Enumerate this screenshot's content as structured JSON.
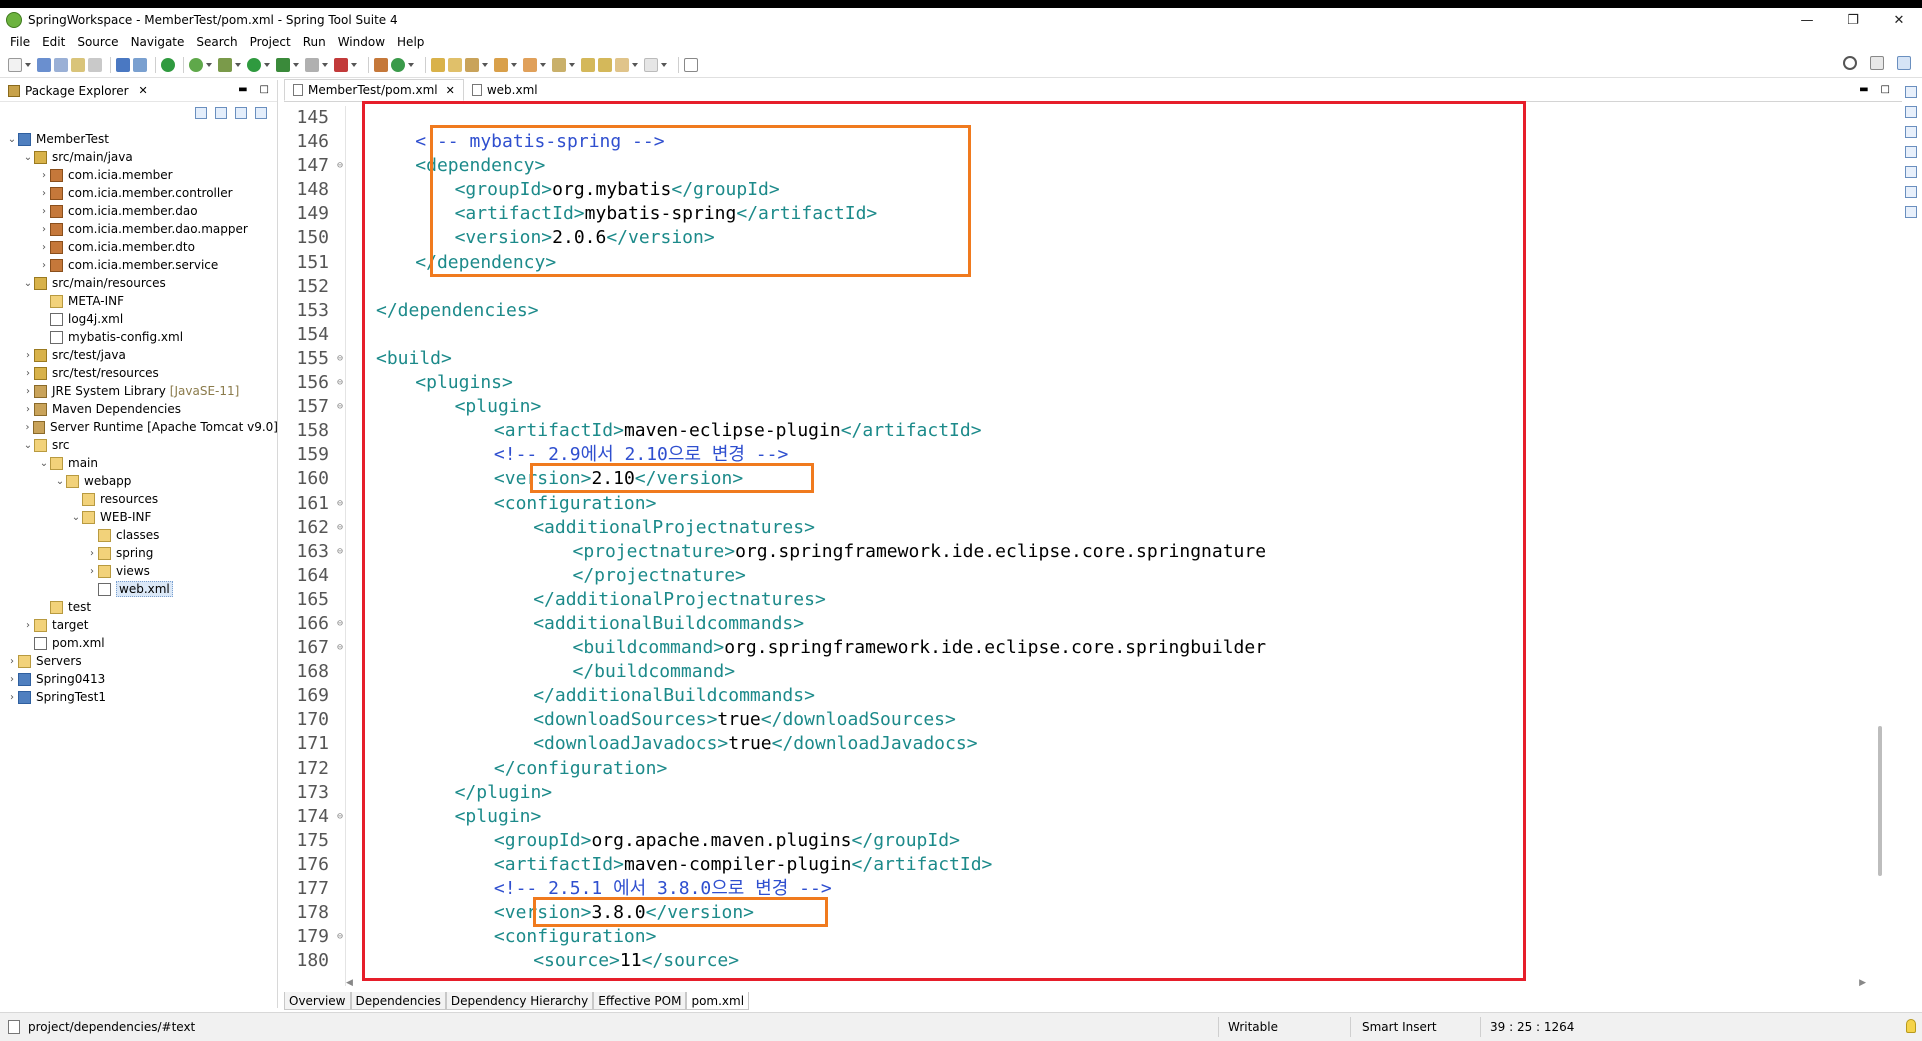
{
  "window": {
    "title": "SpringWorkspace - MemberTest/pom.xml - Spring Tool Suite 4",
    "minimize": "—",
    "maximize": "❐",
    "close": "✕"
  },
  "menus": [
    "File",
    "Edit",
    "Source",
    "Navigate",
    "Search",
    "Project",
    "Run",
    "Window",
    "Help"
  ],
  "package_explorer": {
    "title": "Package Explorer",
    "close": "✕",
    "tree": [
      {
        "depth": 0,
        "tw": "⌄",
        "icon": "project",
        "label": "MemberTest"
      },
      {
        "depth": 1,
        "tw": "⌄",
        "icon": "srcfolder",
        "label": "src/main/java"
      },
      {
        "depth": 2,
        "tw": "›",
        "icon": "package",
        "label": "com.icia.member"
      },
      {
        "depth": 2,
        "tw": "›",
        "icon": "package",
        "label": "com.icia.member.controller"
      },
      {
        "depth": 2,
        "tw": "›",
        "icon": "package",
        "label": "com.icia.member.dao"
      },
      {
        "depth": 2,
        "tw": "›",
        "icon": "package",
        "label": "com.icia.member.dao.mapper"
      },
      {
        "depth": 2,
        "tw": "›",
        "icon": "package",
        "label": "com.icia.member.dto"
      },
      {
        "depth": 2,
        "tw": "›",
        "icon": "package",
        "label": "com.icia.member.service"
      },
      {
        "depth": 1,
        "tw": "⌄",
        "icon": "srcfolder",
        "label": "src/main/resources"
      },
      {
        "depth": 2,
        "tw": "",
        "icon": "folder",
        "label": "META-INF"
      },
      {
        "depth": 2,
        "tw": "",
        "icon": "xml",
        "label": "log4j.xml"
      },
      {
        "depth": 2,
        "tw": "",
        "icon": "xml",
        "label": "mybatis-config.xml"
      },
      {
        "depth": 1,
        "tw": "›",
        "icon": "srcfolder",
        "label": "src/test/java"
      },
      {
        "depth": 1,
        "tw": "›",
        "icon": "srcfolder",
        "label": "src/test/resources"
      },
      {
        "depth": 1,
        "tw": "›",
        "icon": "lib",
        "label": "JRE System Library",
        "suffix": "[JavaSE-11]"
      },
      {
        "depth": 1,
        "tw": "›",
        "icon": "lib",
        "label": "Maven Dependencies"
      },
      {
        "depth": 1,
        "tw": "›",
        "icon": "lib",
        "label": "Server Runtime [Apache Tomcat v9.0]"
      },
      {
        "depth": 1,
        "tw": "⌄",
        "icon": "folder",
        "label": "src"
      },
      {
        "depth": 2,
        "tw": "⌄",
        "icon": "folder",
        "label": "main"
      },
      {
        "depth": 3,
        "tw": "⌄",
        "icon": "folder",
        "label": "webapp"
      },
      {
        "depth": 4,
        "tw": "",
        "icon": "folder",
        "label": "resources"
      },
      {
        "depth": 4,
        "tw": "⌄",
        "icon": "folder",
        "label": "WEB-INF"
      },
      {
        "depth": 5,
        "tw": "",
        "icon": "folder",
        "label": "classes"
      },
      {
        "depth": 5,
        "tw": "›",
        "icon": "folder",
        "label": "spring"
      },
      {
        "depth": 5,
        "tw": "›",
        "icon": "folder",
        "label": "views"
      },
      {
        "depth": 5,
        "tw": "",
        "icon": "xml",
        "label": "web.xml",
        "selected": true
      },
      {
        "depth": 2,
        "tw": "",
        "icon": "folder",
        "label": "test"
      },
      {
        "depth": 1,
        "tw": "›",
        "icon": "folder",
        "label": "target"
      },
      {
        "depth": 1,
        "tw": "",
        "icon": "xml",
        "label": "pom.xml"
      },
      {
        "depth": 0,
        "tw": "›",
        "icon": "folder",
        "label": "Servers"
      },
      {
        "depth": 0,
        "tw": "›",
        "icon": "project",
        "label": "Spring0413"
      },
      {
        "depth": 0,
        "tw": "›",
        "icon": "project",
        "label": "SpringTest1"
      }
    ]
  },
  "editor": {
    "tabs": [
      {
        "label": "MemberTest/pom.xml",
        "active": true,
        "close": "✕"
      },
      {
        "label": "web.xml",
        "active": false
      }
    ],
    "lines": [
      {
        "n": "145",
        "fold": "",
        "indent": 0,
        "segs": []
      },
      {
        "n": "146",
        "fold": "",
        "indent": 1,
        "segs": [
          {
            "t": "<!-- mybatis-spring -->",
            "c": "cmt"
          }
        ]
      },
      {
        "n": "147",
        "fold": "⊖",
        "indent": 1,
        "segs": [
          {
            "t": "<dependency>",
            "c": "tag"
          }
        ]
      },
      {
        "n": "148",
        "fold": "",
        "indent": 2,
        "segs": [
          {
            "t": "<groupId>",
            "c": "tag"
          },
          {
            "t": "org.mybatis",
            "c": "val"
          },
          {
            "t": "</groupId>",
            "c": "tag"
          }
        ]
      },
      {
        "n": "149",
        "fold": "",
        "indent": 2,
        "segs": [
          {
            "t": "<artifactId>",
            "c": "tag"
          },
          {
            "t": "mybatis-spring",
            "c": "val"
          },
          {
            "t": "</artifactId>",
            "c": "tag"
          }
        ]
      },
      {
        "n": "150",
        "fold": "",
        "indent": 2,
        "segs": [
          {
            "t": "<version>",
            "c": "tag"
          },
          {
            "t": "2.0.6",
            "c": "val"
          },
          {
            "t": "</version>",
            "c": "tag"
          }
        ]
      },
      {
        "n": "151",
        "fold": "",
        "indent": 1,
        "segs": [
          {
            "t": "</dependency>",
            "c": "tag"
          }
        ]
      },
      {
        "n": "152",
        "fold": "",
        "indent": 0,
        "segs": []
      },
      {
        "n": "153",
        "fold": "",
        "indent": 0,
        "segs": [
          {
            "t": "</dependencies>",
            "c": "tag"
          }
        ]
      },
      {
        "n": "154",
        "fold": "",
        "indent": 0,
        "segs": []
      },
      {
        "n": "155",
        "fold": "⊖",
        "indent": 0,
        "segs": [
          {
            "t": "<build>",
            "c": "tag"
          }
        ]
      },
      {
        "n": "156",
        "fold": "⊖",
        "indent": 1,
        "segs": [
          {
            "t": "<plugins>",
            "c": "tag"
          }
        ]
      },
      {
        "n": "157",
        "fold": "⊖",
        "indent": 2,
        "segs": [
          {
            "t": "<plugin>",
            "c": "tag"
          }
        ]
      },
      {
        "n": "158",
        "fold": "",
        "indent": 3,
        "segs": [
          {
            "t": "<artifactId>",
            "c": "tag"
          },
          {
            "t": "maven-eclipse-plugin",
            "c": "val"
          },
          {
            "t": "</artifactId>",
            "c": "tag"
          }
        ]
      },
      {
        "n": "159",
        "fold": "",
        "indent": 3,
        "segs": [
          {
            "t": "<!-- 2.9에서 2.10으로 변경 -->",
            "c": "cmt"
          }
        ]
      },
      {
        "n": "160",
        "fold": "",
        "indent": 3,
        "segs": [
          {
            "t": "<version>",
            "c": "tag"
          },
          {
            "t": "2.10",
            "c": "val"
          },
          {
            "t": "</version>",
            "c": "tag"
          }
        ]
      },
      {
        "n": "161",
        "fold": "⊖",
        "indent": 3,
        "segs": [
          {
            "t": "<configuration>",
            "c": "tag"
          }
        ]
      },
      {
        "n": "162",
        "fold": "⊖",
        "indent": 4,
        "segs": [
          {
            "t": "<additionalProjectnatures>",
            "c": "tag"
          }
        ]
      },
      {
        "n": "163",
        "fold": "⊖",
        "indent": 5,
        "segs": [
          {
            "t": "<projectnature>",
            "c": "tag"
          },
          {
            "t": "org.springframework.ide.eclipse.core.springnature",
            "c": "val"
          }
        ]
      },
      {
        "n": "164",
        "fold": "",
        "indent": 5,
        "segs": [
          {
            "t": "</projectnature>",
            "c": "tag"
          }
        ]
      },
      {
        "n": "165",
        "fold": "",
        "indent": 4,
        "segs": [
          {
            "t": "</additionalProjectnatures>",
            "c": "tag"
          }
        ]
      },
      {
        "n": "166",
        "fold": "⊖",
        "indent": 4,
        "segs": [
          {
            "t": "<additionalBuildcommands>",
            "c": "tag"
          }
        ]
      },
      {
        "n": "167",
        "fold": "⊖",
        "indent": 5,
        "segs": [
          {
            "t": "<buildcommand>",
            "c": "tag"
          },
          {
            "t": "org.springframework.ide.eclipse.core.springbuilder",
            "c": "val"
          }
        ]
      },
      {
        "n": "168",
        "fold": "",
        "indent": 5,
        "segs": [
          {
            "t": "</buildcommand>",
            "c": "tag"
          }
        ]
      },
      {
        "n": "169",
        "fold": "",
        "indent": 4,
        "segs": [
          {
            "t": "</additionalBuildcommands>",
            "c": "tag"
          }
        ]
      },
      {
        "n": "170",
        "fold": "",
        "indent": 4,
        "segs": [
          {
            "t": "<downloadSources>",
            "c": "tag"
          },
          {
            "t": "true",
            "c": "val"
          },
          {
            "t": "</downloadSources>",
            "c": "tag"
          }
        ]
      },
      {
        "n": "171",
        "fold": "",
        "indent": 4,
        "segs": [
          {
            "t": "<downloadJavadocs>",
            "c": "tag"
          },
          {
            "t": "true",
            "c": "val"
          },
          {
            "t": "</downloadJavadocs>",
            "c": "tag"
          }
        ]
      },
      {
        "n": "172",
        "fold": "",
        "indent": 3,
        "segs": [
          {
            "t": "</configuration>",
            "c": "tag"
          }
        ]
      },
      {
        "n": "173",
        "fold": "",
        "indent": 2,
        "segs": [
          {
            "t": "</plugin>",
            "c": "tag"
          }
        ]
      },
      {
        "n": "174",
        "fold": "⊖",
        "indent": 2,
        "segs": [
          {
            "t": "<plugin>",
            "c": "tag"
          }
        ]
      },
      {
        "n": "175",
        "fold": "",
        "indent": 3,
        "segs": [
          {
            "t": "<groupId>",
            "c": "tag"
          },
          {
            "t": "org.apache.maven.plugins",
            "c": "val"
          },
          {
            "t": "</groupId>",
            "c": "tag"
          }
        ]
      },
      {
        "n": "176",
        "fold": "",
        "indent": 3,
        "segs": [
          {
            "t": "<artifactId>",
            "c": "tag"
          },
          {
            "t": "maven-compiler-plugin",
            "c": "val"
          },
          {
            "t": "</artifactId>",
            "c": "tag"
          }
        ]
      },
      {
        "n": "177",
        "fold": "",
        "indent": 3,
        "segs": [
          {
            "t": "<!-- 2.5.1 에서 3.8.0으로 변경 -->",
            "c": "cmt"
          }
        ]
      },
      {
        "n": "178",
        "fold": "",
        "indent": 3,
        "segs": [
          {
            "t": "<version>",
            "c": "tag"
          },
          {
            "t": "3.8.0",
            "c": "val"
          },
          {
            "t": "</version>",
            "c": "tag"
          }
        ]
      },
      {
        "n": "179",
        "fold": "⊖",
        "indent": 3,
        "segs": [
          {
            "t": "<configuration>",
            "c": "tag"
          }
        ]
      },
      {
        "n": "180",
        "fold": "",
        "indent": 4,
        "segs": [
          {
            "t": "<source>",
            "c": "tag"
          },
          {
            "t": "11",
            "c": "val"
          },
          {
            "t": "</source>",
            "c": "tag"
          }
        ]
      }
    ],
    "bottom_tabs": [
      {
        "label": "Overview",
        "active": false
      },
      {
        "label": "Dependencies",
        "active": false
      },
      {
        "label": "Dependency Hierarchy",
        "active": false
      },
      {
        "label": "Effective POM",
        "active": false
      },
      {
        "label": "pom.xml",
        "active": true
      }
    ]
  },
  "status": {
    "path": "project/dependencies/#text",
    "writable": "Writable",
    "insert_mode": "Smart Insert",
    "position": "39 : 25 : 1264"
  },
  "colors": {
    "tag": "#1c8a8a",
    "comment": "#2f4fcf",
    "highlight_red": "#e61e2a",
    "highlight_orange": "#f07a1e"
  }
}
